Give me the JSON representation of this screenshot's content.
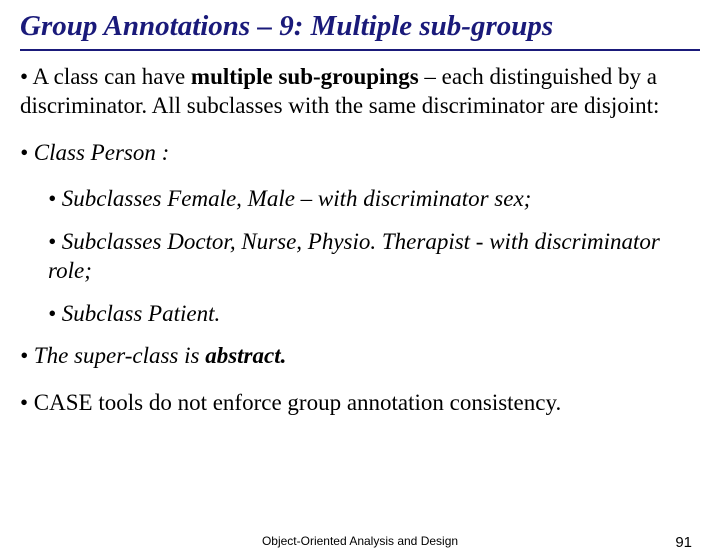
{
  "title": "Group Annotations – 9: Multiple sub-groups",
  "bullets": {
    "b1_pre": "• A class can have ",
    "b1_bold": "multiple sub-groupings",
    "b1_post": " – each distinguished by a discriminator. All subclasses with the same discriminator are disjoint:",
    "b2": "• Class Person :",
    "s1": "• Subclasses Female, Male – with discriminator sex;",
    "s2": "• Subclasses Doctor, Nurse, Physio. Therapist - with discriminator role;",
    "s3": "• Subclass Patient.",
    "b3_pre": "• The super-class is ",
    "b3_bold": "abstract.",
    "b4": "• CASE tools do not enforce group annotation consistency."
  },
  "footer": {
    "center": "Object-Oriented Analysis and Design",
    "page": "91"
  }
}
